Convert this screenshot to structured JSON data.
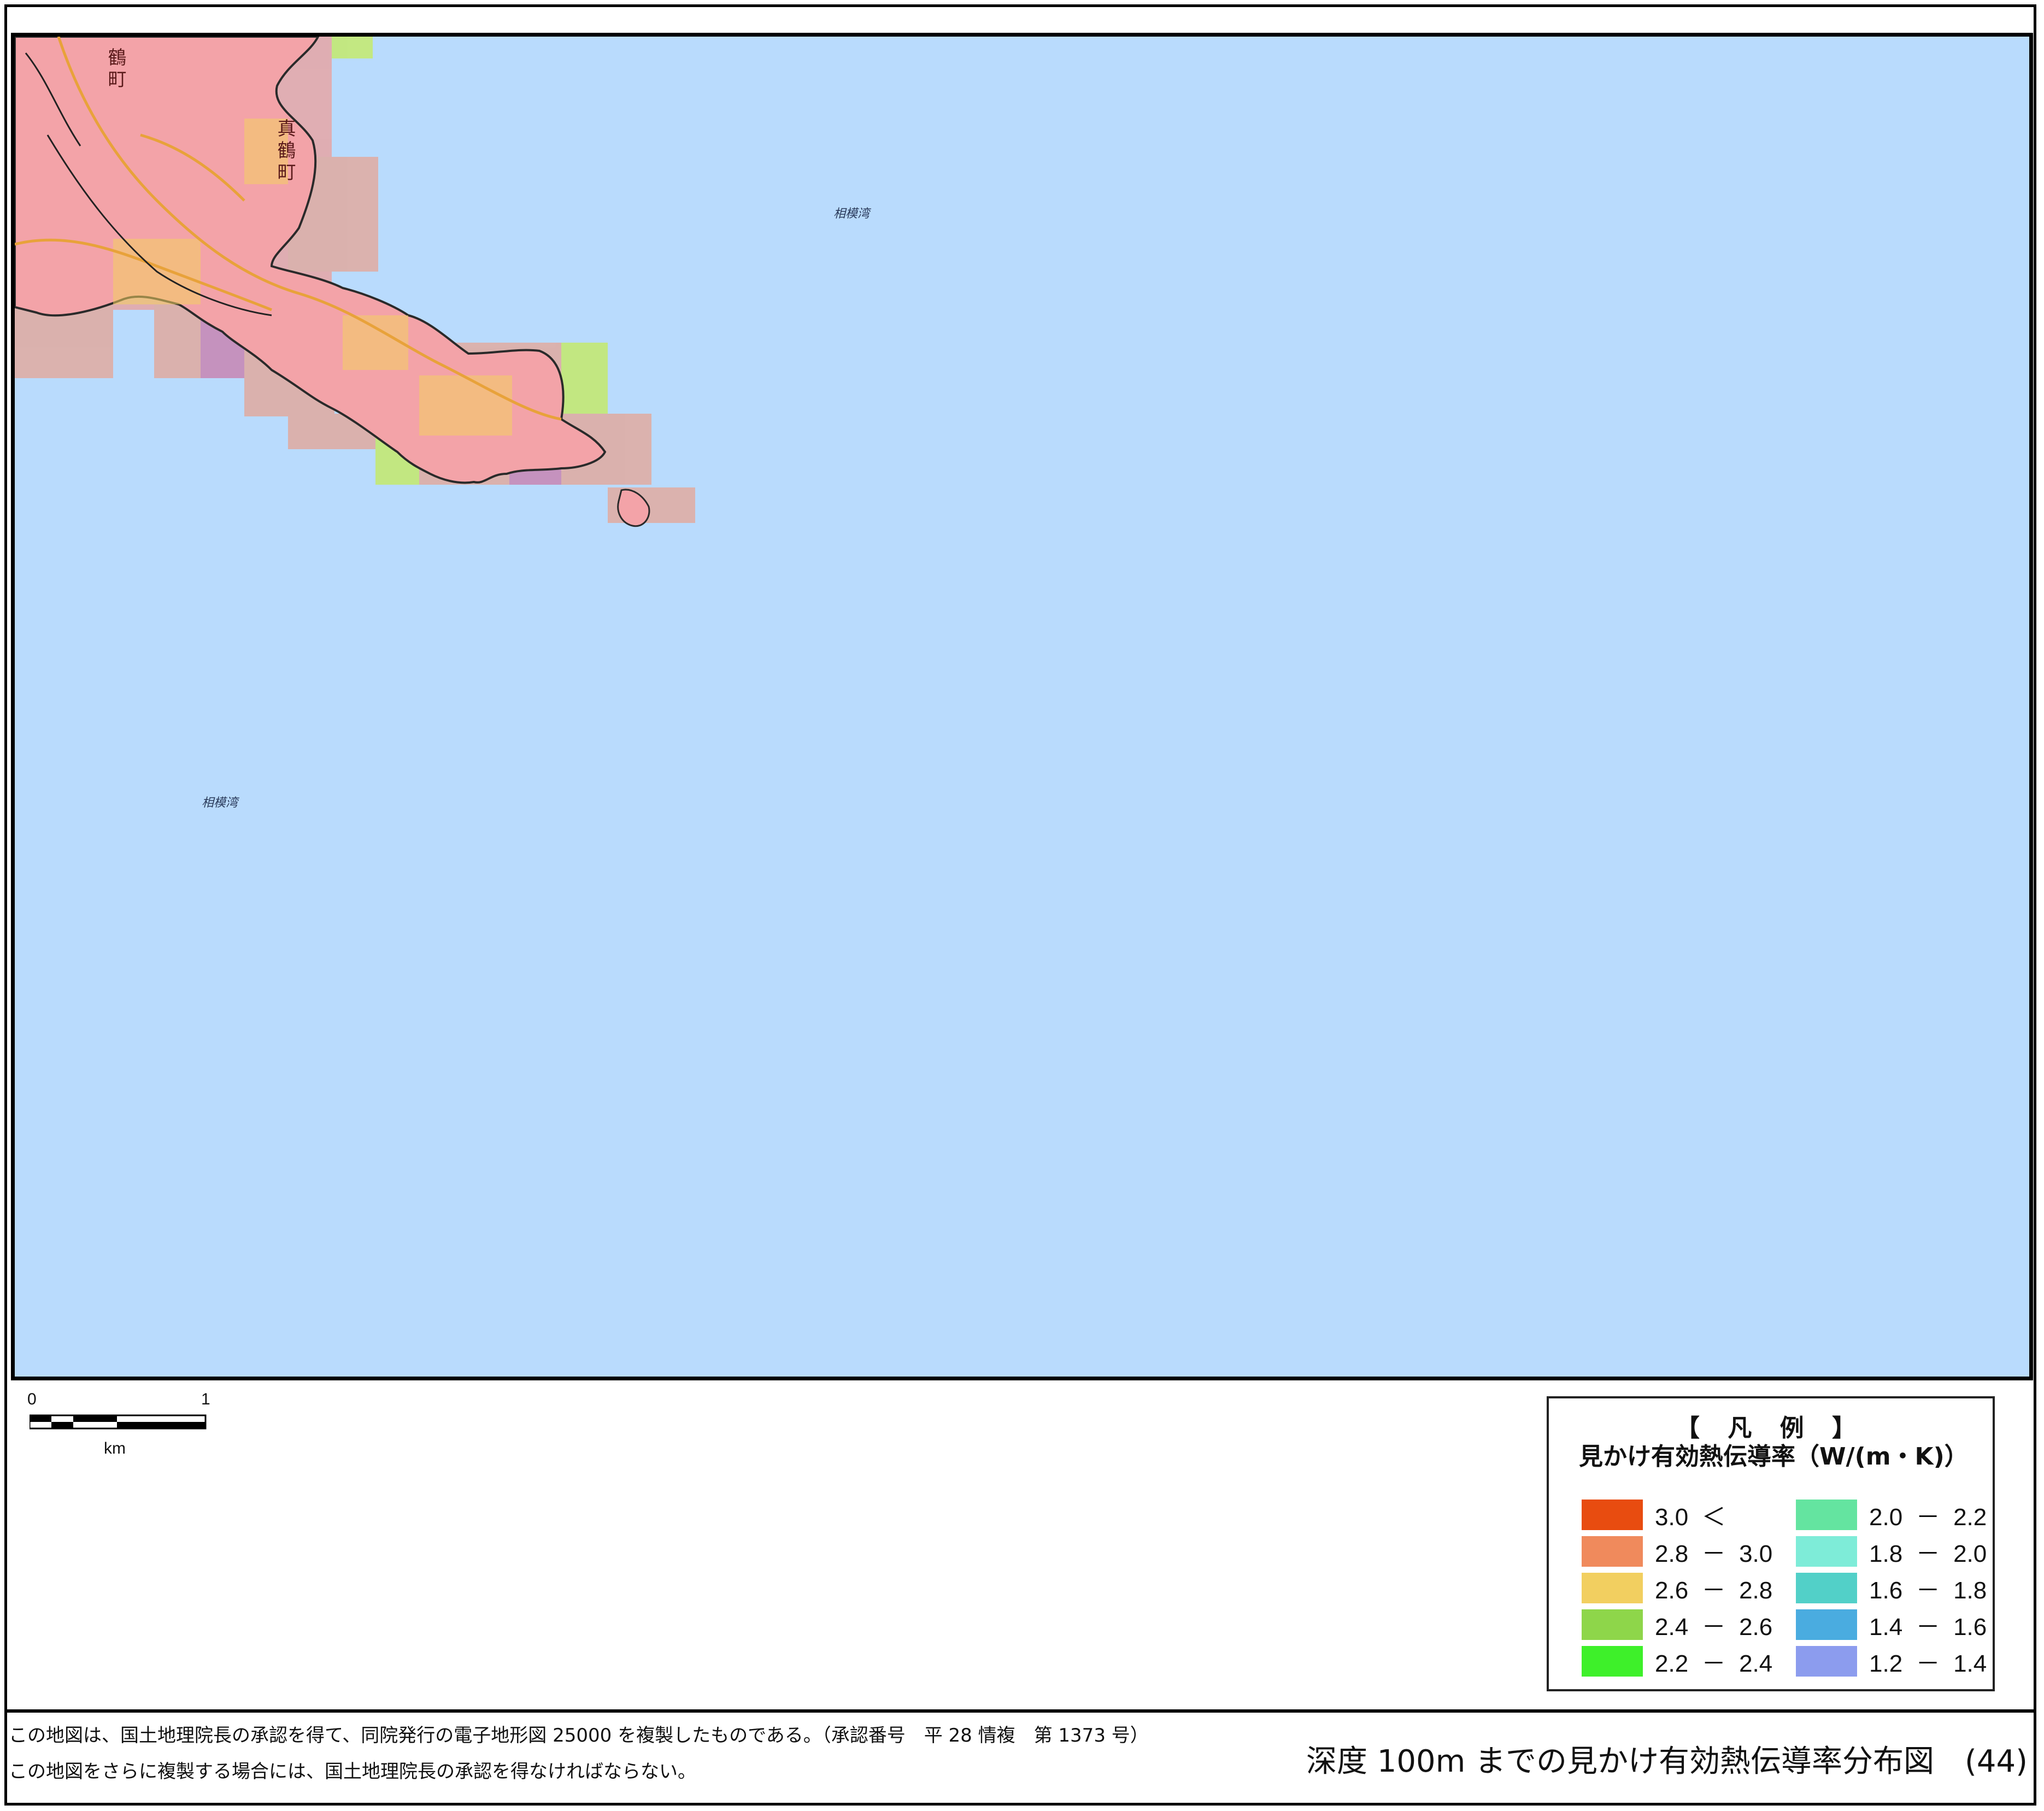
{
  "map": {
    "colors": {
      "sea": "#b9dbfd",
      "land": "#f3a3a8",
      "coast": "#2a2a2a"
    },
    "place_labels": [
      "相模湾",
      "相模湾"
    ],
    "town_labels": [
      "鶴町",
      "真鶴町"
    ]
  },
  "scale_bar": {
    "start": "0",
    "end": "1",
    "unit": "km"
  },
  "legend": {
    "heading": "【 凡 例 】",
    "subtitle": "見かけ有効熱伝導率（W/(m・K)）",
    "items": [
      {
        "label": "3.0  ＜",
        "color": "#e84c10"
      },
      {
        "label": "2.8  －  3.0",
        "color": "#f08a5c"
      },
      {
        "label": "2.6  －  2.8",
        "color": "#f2cf60"
      },
      {
        "label": "2.4  －  2.6",
        "color": "#8ed64a"
      },
      {
        "label": "2.2  －  2.4",
        "color": "#3ef02a"
      },
      {
        "label": "2.0  －  2.2",
        "color": "#64e4a0"
      },
      {
        "label": "1.8  －  2.0",
        "color": "#7eecd8"
      },
      {
        "label": "1.6  －  1.8",
        "color": "#52d0c8"
      },
      {
        "label": "1.4  －  1.6",
        "color": "#4aace0"
      },
      {
        "label": "1.2  －  1.4",
        "color": "#8c9cee"
      }
    ]
  },
  "footer": {
    "credit_line1": "この地図は、国土地理院長の承認を得て、同院発行の電子地形図 25000 を複製したものである。（承認番号　平 28 情複　第 1373 号）",
    "credit_line2": "この地図をさらに複製する場合には、国土地理院長の承認を得なければならない。",
    "title": "深度 100m までの見かけ有効熱伝導率分布図　(44)"
  }
}
